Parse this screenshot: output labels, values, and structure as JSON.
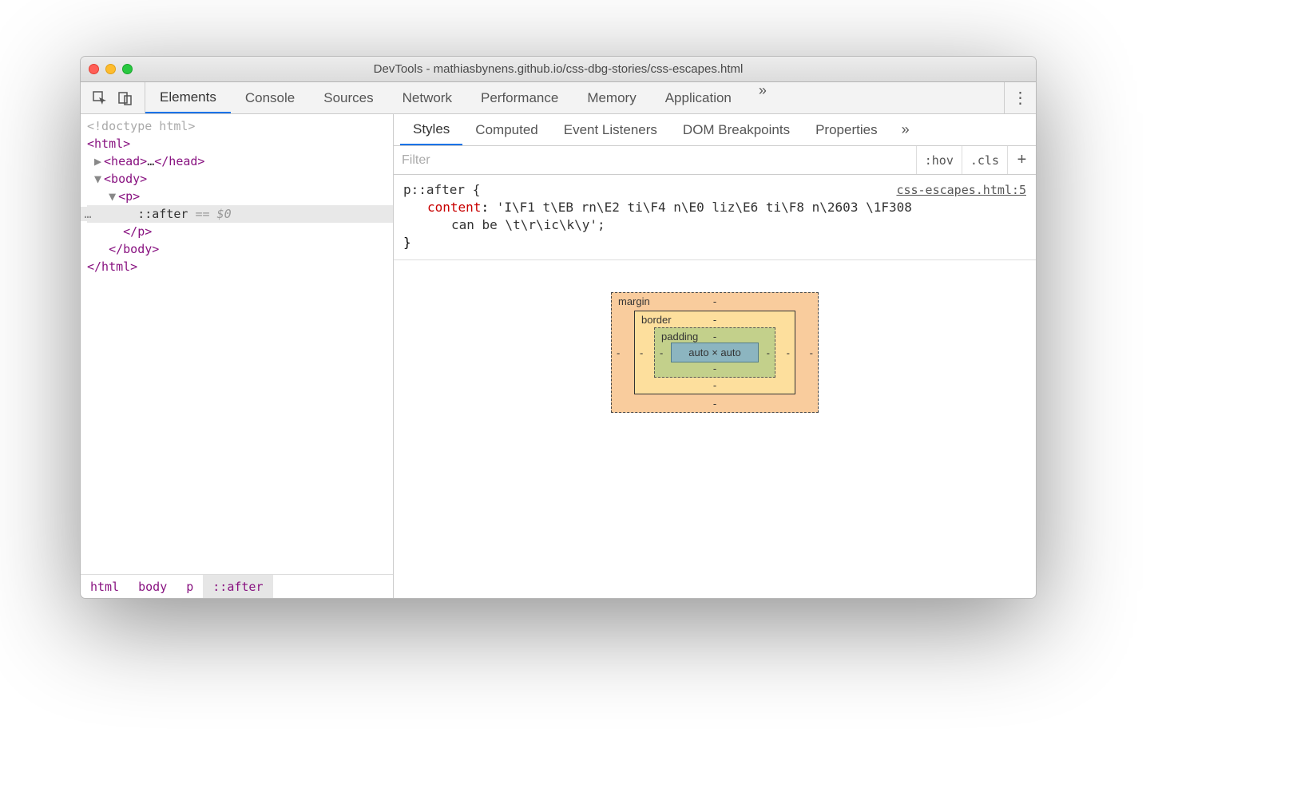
{
  "window": {
    "title": "DevTools - mathiasbynens.github.io/css-dbg-stories/css-escapes.html"
  },
  "main_tabs": {
    "items": [
      "Elements",
      "Console",
      "Sources",
      "Network",
      "Performance",
      "Memory",
      "Application"
    ],
    "overflow": "»"
  },
  "dom": {
    "doctype": "<!doctype html>",
    "html_open": "<html>",
    "head_open": "<head>",
    "head_ellipsis": "…",
    "head_close": "</head>",
    "body_open": "<body>",
    "p_open": "<p>",
    "after": "::after",
    "eq0": "== $0",
    "p_close": "</p>",
    "body_close": "</body>",
    "html_close": "</html>",
    "gutter_ellipsis": "…"
  },
  "breadcrumb": [
    "html",
    "body",
    "p",
    "::after"
  ],
  "sub_tabs": {
    "items": [
      "Styles",
      "Computed",
      "Event Listeners",
      "DOM Breakpoints",
      "Properties"
    ],
    "overflow": "»"
  },
  "filter": {
    "placeholder": "Filter",
    "hov": ":hov",
    "cls": ".cls",
    "plus": "+"
  },
  "rule": {
    "selector": "p::after {",
    "source": "css-escapes.html:5",
    "prop_name": "content",
    "prop_colon": ": ",
    "prop_val_line1": "'I\\F1 t\\EB rn\\E2 ti\\F4 n\\E0 liz\\E6 ti\\F8 n\\2603 \\1F308",
    "prop_val_line2": "can be \\t\\r\\ic\\k\\y';",
    "close": "}"
  },
  "box_model": {
    "margin_label": "margin",
    "border_label": "border",
    "padding_label": "padding",
    "content": "auto × auto",
    "dash": "-"
  }
}
